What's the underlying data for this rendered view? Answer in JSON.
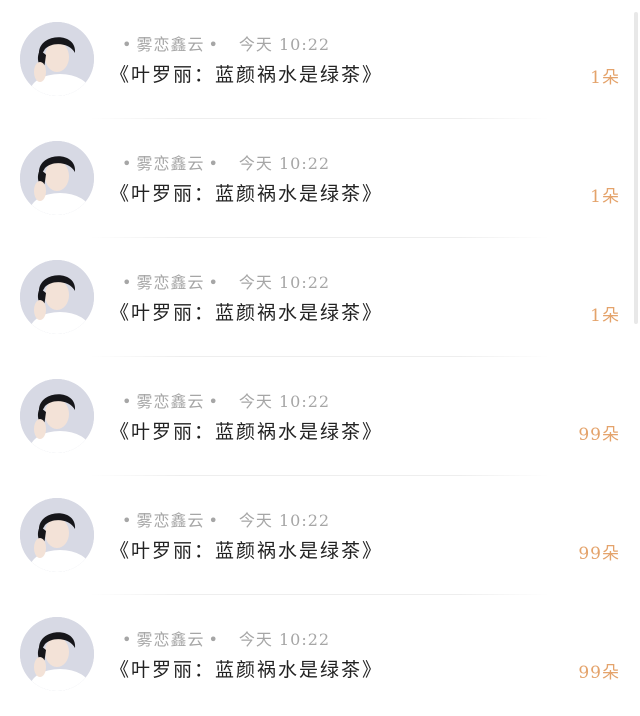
{
  "messages": [
    {
      "sender": "雾恋鑫云",
      "time": "今天 10:22",
      "title": "《叶罗丽：蓝颜祸水是绿茶》",
      "gift": "1朵"
    },
    {
      "sender": "雾恋鑫云",
      "time": "今天 10:22",
      "title": "《叶罗丽：蓝颜祸水是绿茶》",
      "gift": "1朵"
    },
    {
      "sender": "雾恋鑫云",
      "time": "今天 10:22",
      "title": "《叶罗丽：蓝颜祸水是绿茶》",
      "gift": "1朵"
    },
    {
      "sender": "雾恋鑫云",
      "time": "今天 10:22",
      "title": "《叶罗丽：蓝颜祸水是绿茶》",
      "gift": "99朵"
    },
    {
      "sender": "雾恋鑫云",
      "time": "今天 10:22",
      "title": "《叶罗丽：蓝颜祸水是绿茶》",
      "gift": "99朵"
    },
    {
      "sender": "雾恋鑫云",
      "time": "今天 10:22",
      "title": "《叶罗丽：蓝颜祸水是绿茶》",
      "gift": "99朵"
    }
  ],
  "colors": {
    "gift": "#e4a36b",
    "meta": "#a6a6a6",
    "title": "#222222"
  },
  "icons": {
    "avatar": "user-avatar-photo"
  }
}
